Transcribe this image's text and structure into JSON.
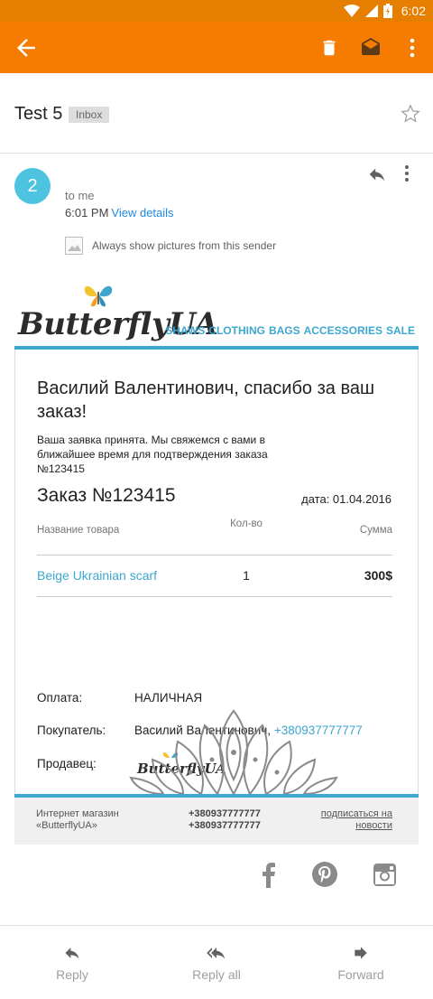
{
  "status": {
    "time": "6:02"
  },
  "appbar": {
    "back_icon": "arrow-back-icon",
    "actions": [
      "delete-icon",
      "mark-unread-icon",
      "more-vert-icon"
    ]
  },
  "message": {
    "subject": "Test 5",
    "label": "Inbox",
    "avatar_letter": "2",
    "to": "to me",
    "time": "6:01 PM",
    "view_details": "View details",
    "show_pictures": "Always show pictures from this sender"
  },
  "email": {
    "brand": "ButterflyUA",
    "nav": [
      "SHAWS",
      "CLOTHING",
      "BAGS",
      "ACCESSORIES",
      "SALE"
    ],
    "thanks": "Василий Валентинович, спасибо за ваш заказ!",
    "accepted": "Ваша заявка принята. Мы свяжемся с вами в ближайшее время для подтверждения заказа №123415",
    "order_title": "Заказ №123415",
    "order_date": "дата: 01.04.2016",
    "table": {
      "headers": [
        "Название товара",
        "Кол-во",
        "Сумма"
      ],
      "rows": [
        {
          "name": "Beige Ukrainian scarf",
          "qty": "1",
          "sum": "300$"
        }
      ]
    },
    "payment_label": "Оплата:",
    "payment_value": "НАЛИЧНАЯ",
    "buyer_label": "Покупатель:",
    "buyer_name": "Василий Валентинович,",
    "buyer_phone": "+380937777777",
    "seller_label": "Продавец:",
    "footer": {
      "shop_line1": "Интернет магазин",
      "shop_line2": "«ButterflyUA»",
      "phone1": "+380937777777",
      "phone2": "+380937777777",
      "subscribe_line1": "подписаться на",
      "subscribe_line2": "новости"
    },
    "social": [
      "facebook-icon",
      "pinterest-icon",
      "instagram-icon"
    ]
  },
  "bottom_actions": {
    "reply": "Reply",
    "reply_all": "Reply all",
    "forward": "Forward"
  },
  "colors": {
    "appbar": "#f57c00",
    "accent_blue": "#3ea6cf",
    "avatar": "#4dc3e0"
  }
}
